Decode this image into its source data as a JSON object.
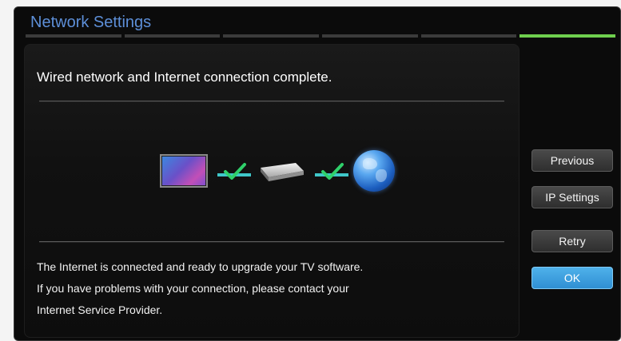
{
  "window": {
    "title": "Network Settings",
    "progress": {
      "steps": 6,
      "current_step": 6,
      "active_color": "#6fcf4e"
    }
  },
  "panel": {
    "headline": "Wired network and Internet connection complete.",
    "diagram": {
      "items": [
        "tv-icon",
        "check-icon",
        "router-icon",
        "check-icon",
        "globe-icon"
      ],
      "check_color": "#3fc7c9"
    },
    "message": [
      "The Internet is connected and ready to upgrade your TV software.",
      "If you have problems with your connection, please contact your",
      "Internet Service Provider."
    ]
  },
  "buttons": {
    "previous": "Previous",
    "ip_settings": "IP Settings",
    "retry": "Retry",
    "ok": "OK"
  },
  "colors": {
    "title": "#5d8fd8",
    "ok_button": "#3a9fe0"
  }
}
